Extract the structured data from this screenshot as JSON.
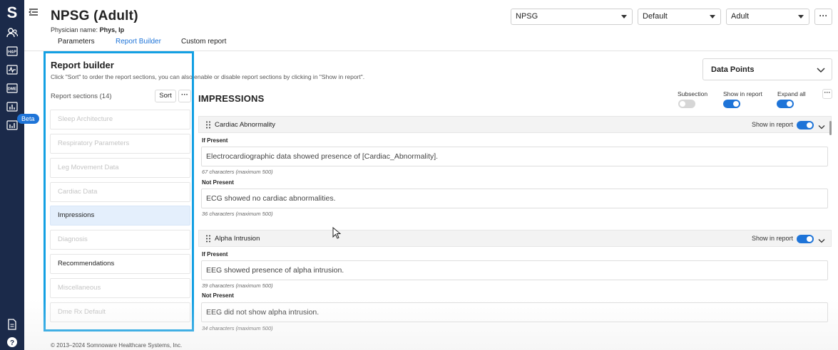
{
  "app": {
    "logo": "S",
    "beta_badge": "Beta"
  },
  "header": {
    "title": "NPSG (Adult)",
    "physician_label": "Physician name:",
    "physician_value": "Phys, Ip",
    "selects": [
      {
        "value": "NPSG"
      },
      {
        "value": "Default"
      },
      {
        "value": "Adult"
      }
    ],
    "more_label": "···"
  },
  "tabs": [
    {
      "label": "Parameters"
    },
    {
      "label": "Report Builder"
    },
    {
      "label": "Custom report"
    }
  ],
  "report_builder": {
    "title": "Report builder",
    "description": "Click \"Sort\" to order the report sections, you can also enable or disable report sections by clicking in \"Show in report\".",
    "sections_label": "Report sections (14)",
    "sort_label": "Sort",
    "more_label": "···",
    "sections": [
      {
        "label": "Sleep Architecture"
      },
      {
        "label": "Respiratory Parameters"
      },
      {
        "label": "Leg Movement Data"
      },
      {
        "label": "Cardiac Data"
      },
      {
        "label": "Impressions"
      },
      {
        "label": "Diagnosis"
      },
      {
        "label": "Recommendations"
      },
      {
        "label": "Miscellaneous"
      },
      {
        "label": "Dme Rx Default"
      }
    ]
  },
  "data_points": {
    "label": "Data Points"
  },
  "impressions": {
    "title": "IMPRESSIONS",
    "subsection_label": "Subsection",
    "show_in_report_label": "Show in report",
    "expand_all_label": "Expand all",
    "more_label": "···",
    "cards": [
      {
        "name": "Cardiac Abnormality",
        "show_label": "Show in report",
        "if_present_label": "If Present",
        "if_present_text": "Electrocardiographic data showed presence of [Cardiac_Abnormality].",
        "if_present_chars": "67 characters (maximum 500)",
        "not_present_label": "Not Present",
        "not_present_text": "ECG showed no cardiac abnormalities.",
        "not_present_chars": "36 characters (maximum 500)"
      },
      {
        "name": "Alpha Intrusion",
        "show_label": "Show in report",
        "if_present_label": "If Present",
        "if_present_text": "EEG showed presence of alpha intrusion.",
        "if_present_chars": "39 characters (maximum 500)",
        "not_present_label": "Not Present",
        "not_present_text": "EEG did not show alpha intrusion.",
        "not_present_chars": "34 characters (maximum 500)"
      }
    ]
  },
  "footer": {
    "text": "© 2013–2024 Somnoware Healthcare Systems, Inc."
  }
}
